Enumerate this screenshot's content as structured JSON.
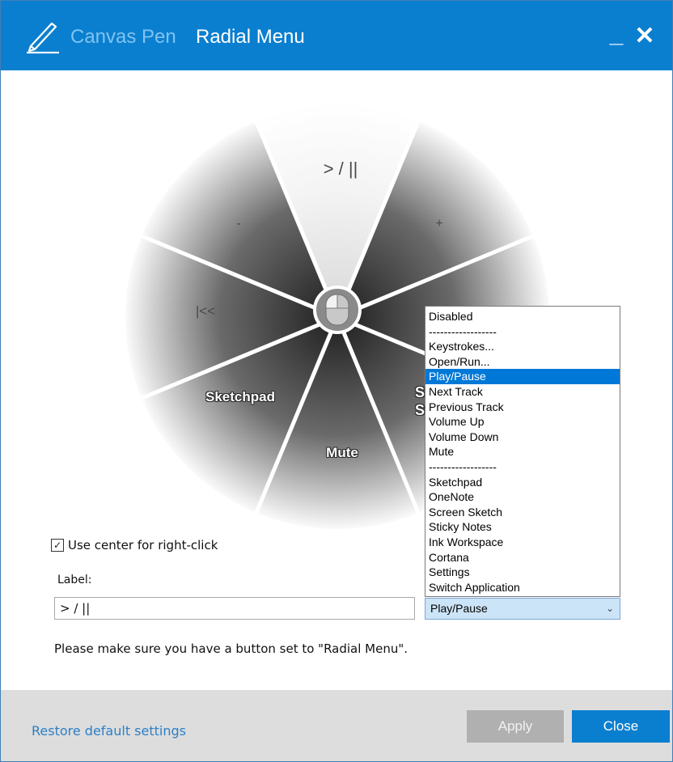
{
  "window": {
    "app_name": "Canvas Pen",
    "page_title": "Radial Menu",
    "minimize_glyph": "_",
    "close_glyph": "✕",
    "accent_color": "#0b7fcf"
  },
  "radial_menu": {
    "segments": [
      {
        "label": "> / ||",
        "style": "dark"
      },
      {
        "label": "+",
        "style": "dark"
      },
      {
        "label": "",
        "style": "dark"
      },
      {
        "label": "",
        "style": "dark"
      },
      {
        "label": "Mute",
        "style": "white"
      },
      {
        "label": "Sketchpad",
        "style": "white"
      },
      {
        "label": "|<<",
        "style": "dark"
      },
      {
        "label": "-",
        "style": "dark"
      }
    ],
    "partially_hidden_label": "Sc\nSt",
    "center_icon": "mouse-icon"
  },
  "options": {
    "use_center_label": "Use center for right-click",
    "use_center_checked": true,
    "label_caption": "Label:",
    "label_value": "> / ||"
  },
  "action_select": {
    "selected": "Play/Pause",
    "options": [
      "Disabled",
      "------------------",
      "Keystrokes...",
      "Open/Run...",
      "Play/Pause",
      "Next Track",
      "Previous Track",
      "Volume Up",
      "Volume Down",
      "Mute",
      "------------------",
      "Sketchpad",
      "OneNote",
      "Screen Sketch",
      "Sticky Notes",
      "Ink Workspace",
      "Cortana",
      "Settings",
      "Switch Application"
    ],
    "highlighted_index": 4
  },
  "note": "Please make sure you have a button set to \"Radial Menu\".",
  "footer": {
    "restore_label": "Restore default settings",
    "apply_label": "Apply",
    "close_label": "Close"
  }
}
